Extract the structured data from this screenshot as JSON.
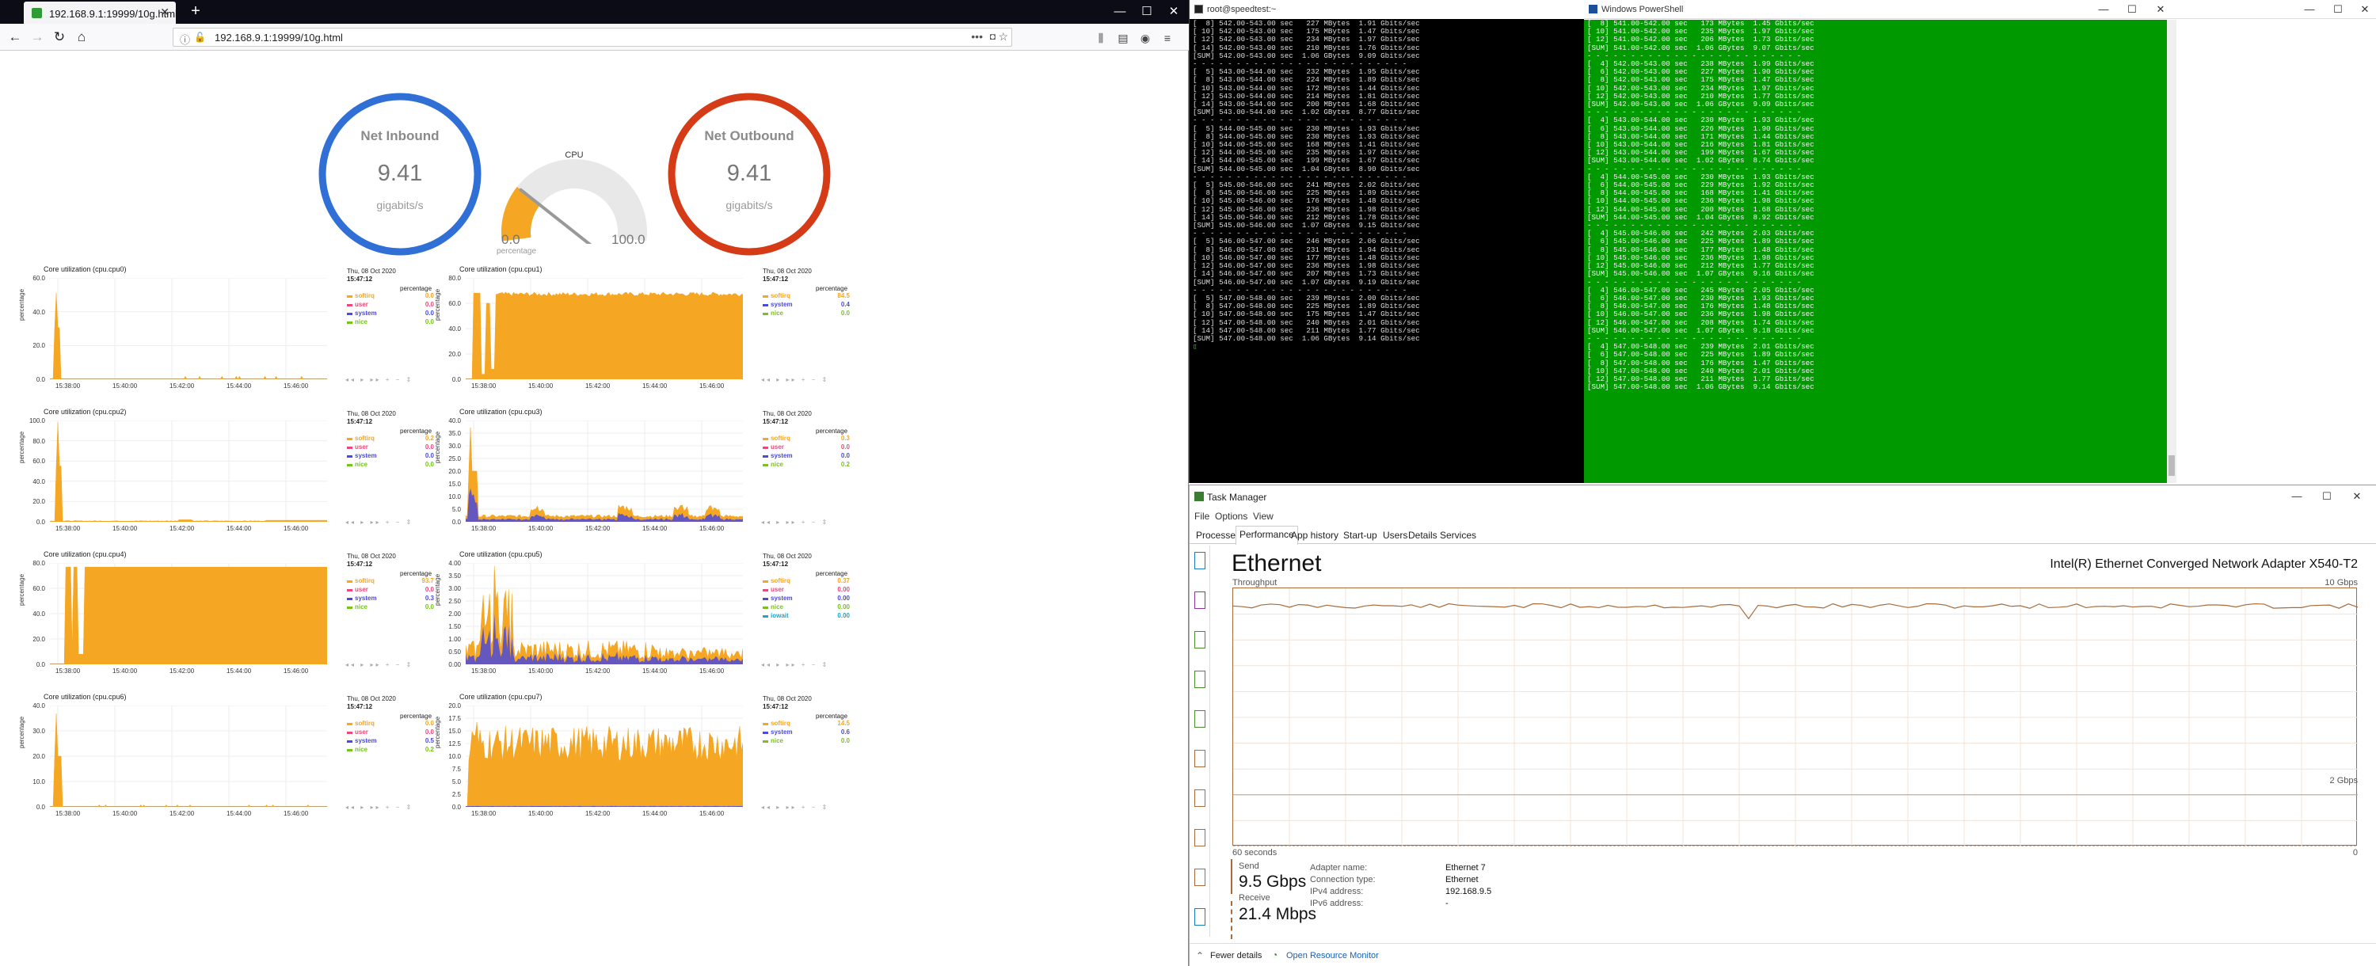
{
  "firefox": {
    "tab_title": "192.168.9.1:19999/10g.html",
    "url": "192.168.9.1:19999/10g.html",
    "content": {
      "gauges": {
        "inbound": {
          "title": "Net Inbound",
          "value": "9.41",
          "unit": "gigabits/s",
          "color": "#2f6fd6"
        },
        "outbound": {
          "title": "Net Outbound",
          "value": "9.41",
          "unit": "gigabits/s",
          "color": "#d43b16"
        },
        "cpu": {
          "title": "CPU",
          "value": "23.4",
          "min": "0.0",
          "max": "100.0",
          "unit": "percentage",
          "level": 0.234,
          "color": "#f5a623"
        }
      },
      "charts": [
        {
          "title": "Core utilization (cpu.cpu0)",
          "date": "Thu, 08 Oct 2020",
          "time": "15:47:12",
          "units": "percentage",
          "yticks": [
            "60.0",
            "40.0",
            "20.0",
            "0.0"
          ],
          "ymax": 80,
          "legend": [
            {
              "name": "softirq",
              "value": "0.0",
              "color": "#f5a623"
            },
            {
              "name": "user",
              "value": "0.0",
              "color": "#e84b7b"
            },
            {
              "name": "system",
              "value": "0.0",
              "color": "#4a4adb"
            },
            {
              "name": "nice",
              "value": "0.0",
              "color": "#77c21d"
            }
          ]
        },
        {
          "title": "Core utilization (cpu.cpu1)",
          "date": "Thu, 08 Oct 2020",
          "time": "15:47:12",
          "units": "percentage",
          "yticks": [
            "80.0",
            "60.0",
            "40.0",
            "20.0",
            "0.0"
          ],
          "ymax": 100,
          "legend": [
            {
              "name": "softirq",
              "value": "84.5",
              "color": "#f5a623"
            },
            {
              "name": "system",
              "value": "0.4",
              "color": "#4a4adb"
            },
            {
              "name": "nice",
              "value": "0.0",
              "color": "#77c21d"
            }
          ]
        },
        {
          "title": "Core utilization (cpu.cpu2)",
          "date": "Thu, 08 Oct 2020",
          "time": "15:47:12",
          "units": "percentage",
          "yticks": [
            "100.0",
            "80.0",
            "60.0",
            "40.0",
            "20.0",
            "0.0"
          ],
          "ymax": 100,
          "legend": [
            {
              "name": "softirq",
              "value": "0.2",
              "color": "#f5a623"
            },
            {
              "name": "user",
              "value": "0.0",
              "color": "#e84b7b"
            },
            {
              "name": "system",
              "value": "0.0",
              "color": "#4a4adb"
            },
            {
              "name": "nice",
              "value": "0.0",
              "color": "#77c21d"
            }
          ]
        },
        {
          "title": "Core utilization (cpu.cpu3)",
          "date": "Thu, 08 Oct 2020",
          "time": "15:47:12",
          "units": "percentage",
          "yticks": [
            "40.0",
            "35.0",
            "30.0",
            "25.0",
            "20.0",
            "15.0",
            "10.0",
            "5.0",
            "0.0"
          ],
          "ymax": 40,
          "legend": [
            {
              "name": "softirq",
              "value": "0.3",
              "color": "#f5a623"
            },
            {
              "name": "user",
              "value": "0.0",
              "color": "#e84b7b"
            },
            {
              "name": "system",
              "value": "0.0",
              "color": "#4a4adb"
            },
            {
              "name": "nice",
              "value": "0.2",
              "color": "#77c21d"
            }
          ]
        },
        {
          "title": "Core utilization (cpu.cpu4)",
          "date": "Thu, 08 Oct 2020",
          "time": "15:47:12",
          "units": "percentage",
          "yticks": [
            "80.0",
            "60.0",
            "40.0",
            "20.0",
            "0.0"
          ],
          "ymax": 100,
          "legend": [
            {
              "name": "softirq",
              "value": "93.7",
              "color": "#f5a623"
            },
            {
              "name": "user",
              "value": "0.0",
              "color": "#e84b7b"
            },
            {
              "name": "system",
              "value": "0.3",
              "color": "#4a4adb"
            },
            {
              "name": "nice",
              "value": "0.0",
              "color": "#77c21d"
            }
          ]
        },
        {
          "title": "Core utilization (cpu.cpu5)",
          "date": "Thu, 08 Oct 2020",
          "time": "15:47:12",
          "units": "percentage",
          "yticks": [
            "4.00",
            "3.50",
            "3.00",
            "2.50",
            "2.00",
            "1.50",
            "1.00",
            "0.50",
            "0.00"
          ],
          "ymax": 4,
          "legend": [
            {
              "name": "softirq",
              "value": "0.37",
              "color": "#f5a623"
            },
            {
              "name": "user",
              "value": "0.00",
              "color": "#e84b7b"
            },
            {
              "name": "system",
              "value": "0.00",
              "color": "#4a4adb"
            },
            {
              "name": "nice",
              "value": "0.00",
              "color": "#77c21d"
            },
            {
              "name": "iowait",
              "value": "0.00",
              "color": "#1da5c7"
            }
          ]
        },
        {
          "title": "Core utilization (cpu.cpu6)",
          "date": "Thu, 08 Oct 2020",
          "time": "15:47:12",
          "units": "percentage",
          "yticks": [
            "40.0",
            "30.0",
            "20.0",
            "10.0",
            "0.0"
          ],
          "ymax": 45,
          "legend": [
            {
              "name": "softirq",
              "value": "0.0",
              "color": "#f5a623"
            },
            {
              "name": "user",
              "value": "0.0",
              "color": "#e84b7b"
            },
            {
              "name": "system",
              "value": "0.5",
              "color": "#4a4adb"
            },
            {
              "name": "nice",
              "value": "0.2",
              "color": "#77c21d"
            }
          ]
        },
        {
          "title": "Core utilization (cpu.cpu7)",
          "date": "Thu, 08 Oct 2020",
          "time": "15:47:12",
          "units": "percentage",
          "yticks": [
            "20.0",
            "17.5",
            "15.0",
            "12.5",
            "10.0",
            "7.5",
            "5.0",
            "2.5",
            "0.0"
          ],
          "ymax": 20,
          "legend": [
            {
              "name": "softirq",
              "value": "14.5",
              "color": "#f5a623"
            },
            {
              "name": "system",
              "value": "0.6",
              "color": "#4a4adb"
            },
            {
              "name": "nice",
              "value": "0.0",
              "color": "#77c21d"
            }
          ]
        }
      ],
      "xticks": [
        "15:38:00",
        "15:40:00",
        "15:42:00",
        "15:44:00",
        "15:46:00"
      ]
    }
  },
  "chart_data": [
    {
      "type": "area",
      "title": "Core utilization (cpu.cpu0)",
      "ylabel": "percentage",
      "x": [
        "15:38:00",
        "15:40:00",
        "15:42:00",
        "15:44:00",
        "15:46:00"
      ],
      "ylim": [
        0,
        80
      ],
      "series": [
        {
          "name": "softirq",
          "values": [
            0,
            0,
            0,
            0,
            0
          ]
        }
      ]
    },
    {
      "type": "area",
      "title": "Core utilization (cpu.cpu1)",
      "ylabel": "percentage",
      "x": [
        "15:38:00",
        "15:40:00",
        "15:42:00",
        "15:44:00",
        "15:46:00"
      ],
      "ylim": [
        0,
        100
      ],
      "series": [
        {
          "name": "softirq",
          "values": [
            85,
            84,
            85,
            84,
            84.5
          ]
        }
      ]
    },
    {
      "type": "area",
      "title": "Core utilization (cpu.cpu2)",
      "ylabel": "percentage",
      "x": [
        "15:38:00",
        "15:40:00",
        "15:42:00",
        "15:44:00",
        "15:46:00"
      ],
      "ylim": [
        0,
        100
      ],
      "series": [
        {
          "name": "softirq",
          "values": [
            0.5,
            0.3,
            0.2,
            0.3,
            0.2
          ]
        }
      ]
    },
    {
      "type": "area",
      "title": "Core utilization (cpu.cpu3)",
      "ylabel": "percentage",
      "x": [
        "15:38:00",
        "15:40:00",
        "15:42:00",
        "15:44:00",
        "15:46:00"
      ],
      "ylim": [
        0,
        40
      ],
      "series": [
        {
          "name": "softirq",
          "values": [
            2,
            2,
            4,
            3,
            2
          ]
        }
      ]
    },
    {
      "type": "area",
      "title": "Core utilization (cpu.cpu4)",
      "ylabel": "percentage",
      "x": [
        "15:38:00",
        "15:40:00",
        "15:42:00",
        "15:44:00",
        "15:46:00"
      ],
      "ylim": [
        0,
        100
      ],
      "series": [
        {
          "name": "softirq",
          "values": [
            94,
            94,
            94,
            94,
            93.7
          ]
        }
      ]
    },
    {
      "type": "area",
      "title": "Core utilization (cpu.cpu5)",
      "ylabel": "percentage",
      "x": [
        "15:38:00",
        "15:40:00",
        "15:42:00",
        "15:44:00",
        "15:46:00"
      ],
      "ylim": [
        0,
        4
      ],
      "series": [
        {
          "name": "softirq",
          "values": [
            0.9,
            0.6,
            0.5,
            0.5,
            0.37
          ]
        }
      ]
    },
    {
      "type": "area",
      "title": "Core utilization (cpu.cpu6)",
      "ylabel": "percentage",
      "x": [
        "15:38:00",
        "15:40:00",
        "15:42:00",
        "15:44:00",
        "15:46:00"
      ],
      "ylim": [
        0,
        45
      ],
      "series": [
        {
          "name": "softirq",
          "values": [
            0.5,
            0.3,
            0.3,
            0.3,
            0.0
          ]
        }
      ]
    },
    {
      "type": "area",
      "title": "Core utilization (cpu.cpu7)",
      "ylabel": "percentage",
      "x": [
        "15:38:00",
        "15:40:00",
        "15:42:00",
        "15:44:00",
        "15:46:00"
      ],
      "ylim": [
        0,
        20
      ],
      "series": [
        {
          "name": "softirq",
          "values": [
            14,
            15,
            14.5,
            15,
            14.5
          ]
        }
      ]
    }
  ],
  "terminal": {
    "title": "root@speedtest:~",
    "lines": [
      "[  8] 542.00-543.00 sec   227 MBytes  1.91 Gbits/sec",
      "[ 10] 542.00-543.00 sec   175 MBytes  1.47 Gbits/sec",
      "[ 12] 542.00-543.00 sec   234 MBytes  1.97 Gbits/sec",
      "[ 14] 542.00-543.00 sec   210 MBytes  1.76 Gbits/sec",
      "[SUM] 542.00-543.00 sec  1.06 GBytes  9.09 Gbits/sec",
      "- - - - - - - - - - - - - - - - - - - - - - - - -",
      "[  5] 543.00-544.00 sec   232 MBytes  1.95 Gbits/sec",
      "[  8] 543.00-544.00 sec   224 MBytes  1.89 Gbits/sec",
      "[ 10] 543.00-544.00 sec   172 MBytes  1.44 Gbits/sec",
      "[ 12] 543.00-544.00 sec   214 MBytes  1.81 Gbits/sec",
      "[ 14] 543.00-544.00 sec   200 MBytes  1.68 Gbits/sec",
      "[SUM] 543.00-544.00 sec  1.02 GBytes  8.77 Gbits/sec",
      "- - - - - - - - - - - - - - - - - - - - - - - - -",
      "[  5] 544.00-545.00 sec   230 MBytes  1.93 Gbits/sec",
      "[  8] 544.00-545.00 sec   230 MBytes  1.93 Gbits/sec",
      "[ 10] 544.00-545.00 sec   168 MBytes  1.41 Gbits/sec",
      "[ 12] 544.00-545.00 sec   235 MBytes  1.97 Gbits/sec",
      "[ 14] 544.00-545.00 sec   199 MBytes  1.67 Gbits/sec",
      "[SUM] 544.00-545.00 sec  1.04 GBytes  8.90 Gbits/sec",
      "- - - - - - - - - - - - - - - - - - - - - - - - -",
      "[  5] 545.00-546.00 sec   241 MBytes  2.02 Gbits/sec",
      "[  8] 545.00-546.00 sec   225 MBytes  1.89 Gbits/sec",
      "[ 10] 545.00-546.00 sec   176 MBytes  1.48 Gbits/sec",
      "[ 12] 545.00-546.00 sec   236 MBytes  1.98 Gbits/sec",
      "[ 14] 545.00-546.00 sec   212 MBytes  1.78 Gbits/sec",
      "[SUM] 545.00-546.00 sec  1.07 GBytes  9.15 Gbits/sec",
      "- - - - - - - - - - - - - - - - - - - - - - - - -",
      "[  5] 546.00-547.00 sec   246 MBytes  2.06 Gbits/sec",
      "[  8] 546.00-547.00 sec   231 MBytes  1.94 Gbits/sec",
      "[ 10] 546.00-547.00 sec   177 MBytes  1.48 Gbits/sec",
      "[ 12] 546.00-547.00 sec   236 MBytes  1.98 Gbits/sec",
      "[ 14] 546.00-547.00 sec   207 MBytes  1.73 Gbits/sec",
      "[SUM] 546.00-547.00 sec  1.07 GBytes  9.19 Gbits/sec",
      "- - - - - - - - - - - - - - - - - - - - - - - - -",
      "[  5] 547.00-548.00 sec   239 MBytes  2.00 Gbits/sec",
      "[  8] 547.00-548.00 sec   225 MBytes  1.89 Gbits/sec",
      "[ 10] 547.00-548.00 sec   175 MBytes  1.47 Gbits/sec",
      "[ 12] 547.00-548.00 sec   240 MBytes  2.01 Gbits/sec",
      "[ 14] 547.00-548.00 sec   211 MBytes  1.77 Gbits/sec",
      "[SUM] 547.00-548.00 sec  1.06 GBytes  9.14 Gbits/sec"
    ]
  },
  "powershell": {
    "title": "Windows PowerShell",
    "lines": [
      "[  8] 541.00-542.00 sec   173 MBytes  1.45 Gbits/sec",
      "[ 10] 541.00-542.00 sec   235 MBytes  1.97 Gbits/sec",
      "[ 12] 541.00-542.00 sec   206 MBytes  1.73 Gbits/sec",
      "[SUM] 541.00-542.00 sec  1.06 GBytes  9.07 Gbits/sec",
      "- - - - - - - - - - - - - - - - - - - - - - - - -",
      "[  4] 542.00-543.00 sec   238 MBytes  1.99 Gbits/sec",
      "[  6] 542.00-543.00 sec   227 MBytes  1.90 Gbits/sec",
      "[  8] 542.00-543.00 sec   175 MBytes  1.47 Gbits/sec",
      "[ 10] 542.00-543.00 sec   234 MBytes  1.97 Gbits/sec",
      "[ 12] 542.00-543.00 sec   210 MBytes  1.77 Gbits/sec",
      "[SUM] 542.00-543.00 sec  1.06 GBytes  9.09 Gbits/sec",
      "- - - - - - - - - - - - - - - - - - - - - - - - -",
      "[  4] 543.00-544.00 sec   230 MBytes  1.93 Gbits/sec",
      "[  6] 543.00-544.00 sec   226 MBytes  1.90 Gbits/sec",
      "[  8] 543.00-544.00 sec   171 MBytes  1.44 Gbits/sec",
      "[ 10] 543.00-544.00 sec   216 MBytes  1.81 Gbits/sec",
      "[ 12] 543.00-544.00 sec   199 MBytes  1.67 Gbits/sec",
      "[SUM] 543.00-544.00 sec  1.02 GBytes  8.74 Gbits/sec",
      "- - - - - - - - - - - - - - - - - - - - - - - - -",
      "[  4] 544.00-545.00 sec   230 MBytes  1.93 Gbits/sec",
      "[  6] 544.00-545.00 sec   229 MBytes  1.92 Gbits/sec",
      "[  8] 544.00-545.00 sec   168 MBytes  1.41 Gbits/sec",
      "[ 10] 544.00-545.00 sec   236 MBytes  1.98 Gbits/sec",
      "[ 12] 544.00-545.00 sec   200 MBytes  1.68 Gbits/sec",
      "[SUM] 544.00-545.00 sec  1.04 GBytes  8.92 Gbits/sec",
      "- - - - - - - - - - - - - - - - - - - - - - - - -",
      "[  4] 545.00-546.00 sec   242 MBytes  2.03 Gbits/sec",
      "[  6] 545.00-546.00 sec   225 MBytes  1.89 Gbits/sec",
      "[  8] 545.00-546.00 sec   177 MBytes  1.48 Gbits/sec",
      "[ 10] 545.00-546.00 sec   236 MBytes  1.98 Gbits/sec",
      "[ 12] 545.00-546.00 sec   212 MBytes  1.77 Gbits/sec",
      "[SUM] 545.00-546.00 sec  1.07 GBytes  9.16 Gbits/sec",
      "- - - - - - - - - - - - - - - - - - - - - - - - -",
      "[  4] 546.00-547.00 sec   245 MBytes  2.05 Gbits/sec",
      "[  6] 546.00-547.00 sec   230 MBytes  1.93 Gbits/sec",
      "[  8] 546.00-547.00 sec   176 MBytes  1.48 Gbits/sec",
      "[ 10] 546.00-547.00 sec   236 MBytes  1.98 Gbits/sec",
      "[ 12] 546.00-547.00 sec   208 MBytes  1.74 Gbits/sec",
      "[SUM] 546.00-547.00 sec  1.07 GBytes  9.18 Gbits/sec",
      "- - - - - - - - - - - - - - - - - - - - - - - - -",
      "[  4] 547.00-548.00 sec   239 MBytes  2.01 Gbits/sec",
      "[  6] 547.00-548.00 sec   225 MBytes  1.89 Gbits/sec",
      "[  8] 547.00-548.00 sec   176 MBytes  1.47 Gbits/sec",
      "[ 10] 547.00-548.00 sec   240 MBytes  2.01 Gbits/sec",
      "[ 12] 547.00-548.00 sec   211 MBytes  1.77 Gbits/sec",
      "[SUM] 547.00-548.00 sec  1.06 GBytes  9.14 Gbits/sec"
    ]
  },
  "task_manager": {
    "title": "Task Manager",
    "menu": [
      "File",
      "Options",
      "View"
    ],
    "tabs": [
      "Processes",
      "Performance",
      "App history",
      "Start-up",
      "Users",
      "Details",
      "Services"
    ],
    "heading": "Ethernet",
    "adapter": "Intel(R) Ethernet Converged Network Adapter X540-T2",
    "throughput_label": "Throughput",
    "scale_max": "10 Gbps",
    "scale_mid": "2 Gbps",
    "x_start": "60 seconds",
    "x_end": "0",
    "send_label": "Send",
    "send_value": "9.5 Gbps",
    "receive_label": "Receive",
    "receive_value": "21.4 Mbps",
    "props": [
      {
        "key": "Adapter name:",
        "value": "Ethernet 7"
      },
      {
        "key": "Connection type:",
        "value": "Ethernet"
      },
      {
        "key": "IPv4 address:",
        "value": "192.168.9.5"
      },
      {
        "key": "IPv6 address:",
        "value": "-"
      }
    ],
    "fewer_details": "Fewer details",
    "open_monitor": "Open Resource Monitor",
    "graph_color": "#a86b39"
  }
}
